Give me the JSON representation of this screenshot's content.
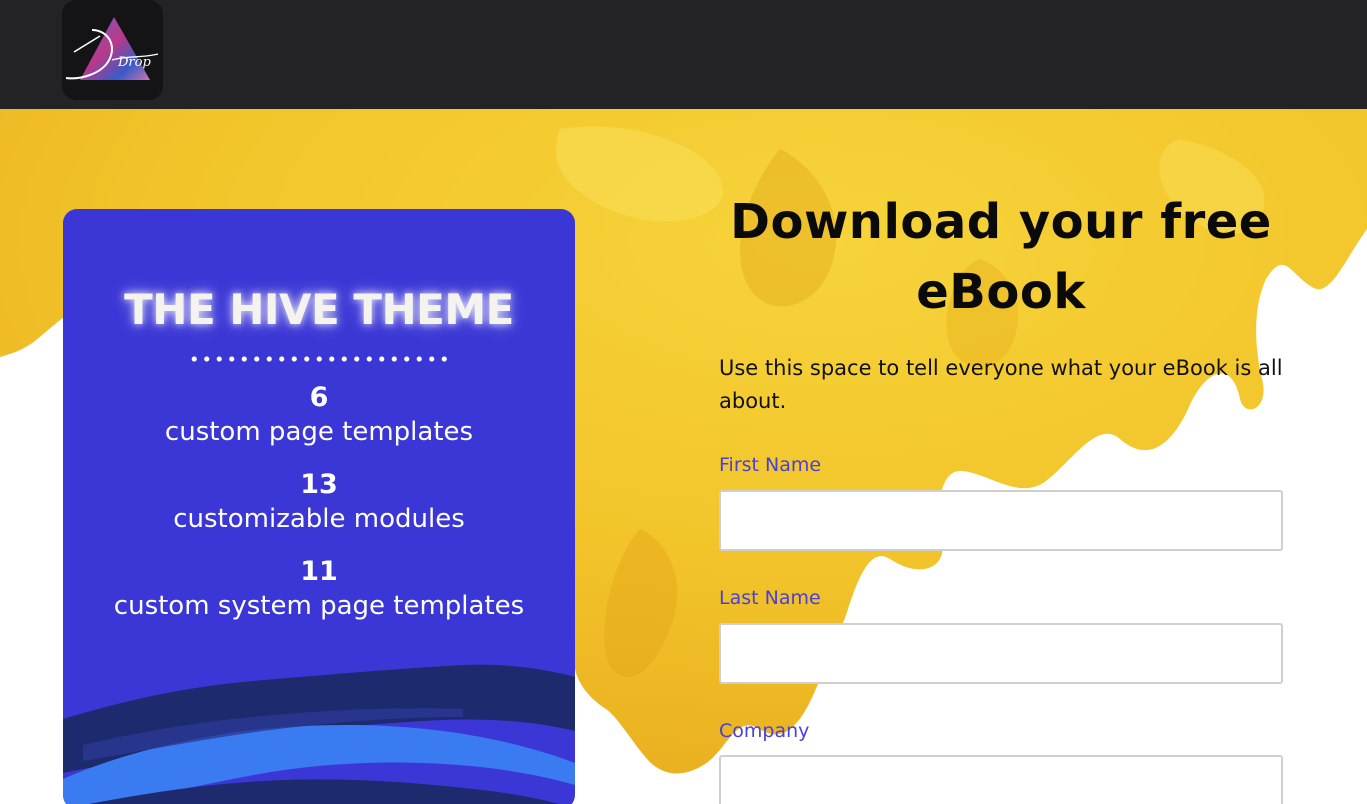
{
  "header": {
    "logo_icon": "drop-triangle-logo",
    "logo_text": "Drop"
  },
  "card": {
    "title": "THE HIVE THEME",
    "background_color": "#3b37d6",
    "stats": [
      {
        "number": "6",
        "label": "custom page templates"
      },
      {
        "number": "13",
        "label": "customizable modules"
      },
      {
        "number": "11",
        "label": "custom system page templates"
      }
    ]
  },
  "main": {
    "headline": "Download your free eBook",
    "intro": "Use this space to tell everyone what your eBook is all about."
  },
  "form": {
    "first_name_label": "First Name",
    "first_name_value": "",
    "last_name_label": "Last Name",
    "last_name_value": "",
    "company_label": "Company",
    "company_value": "",
    "label_color": "#4a3fd6"
  },
  "colors": {
    "header_bg": "#232326",
    "splash_yellow": "#f3c623"
  }
}
